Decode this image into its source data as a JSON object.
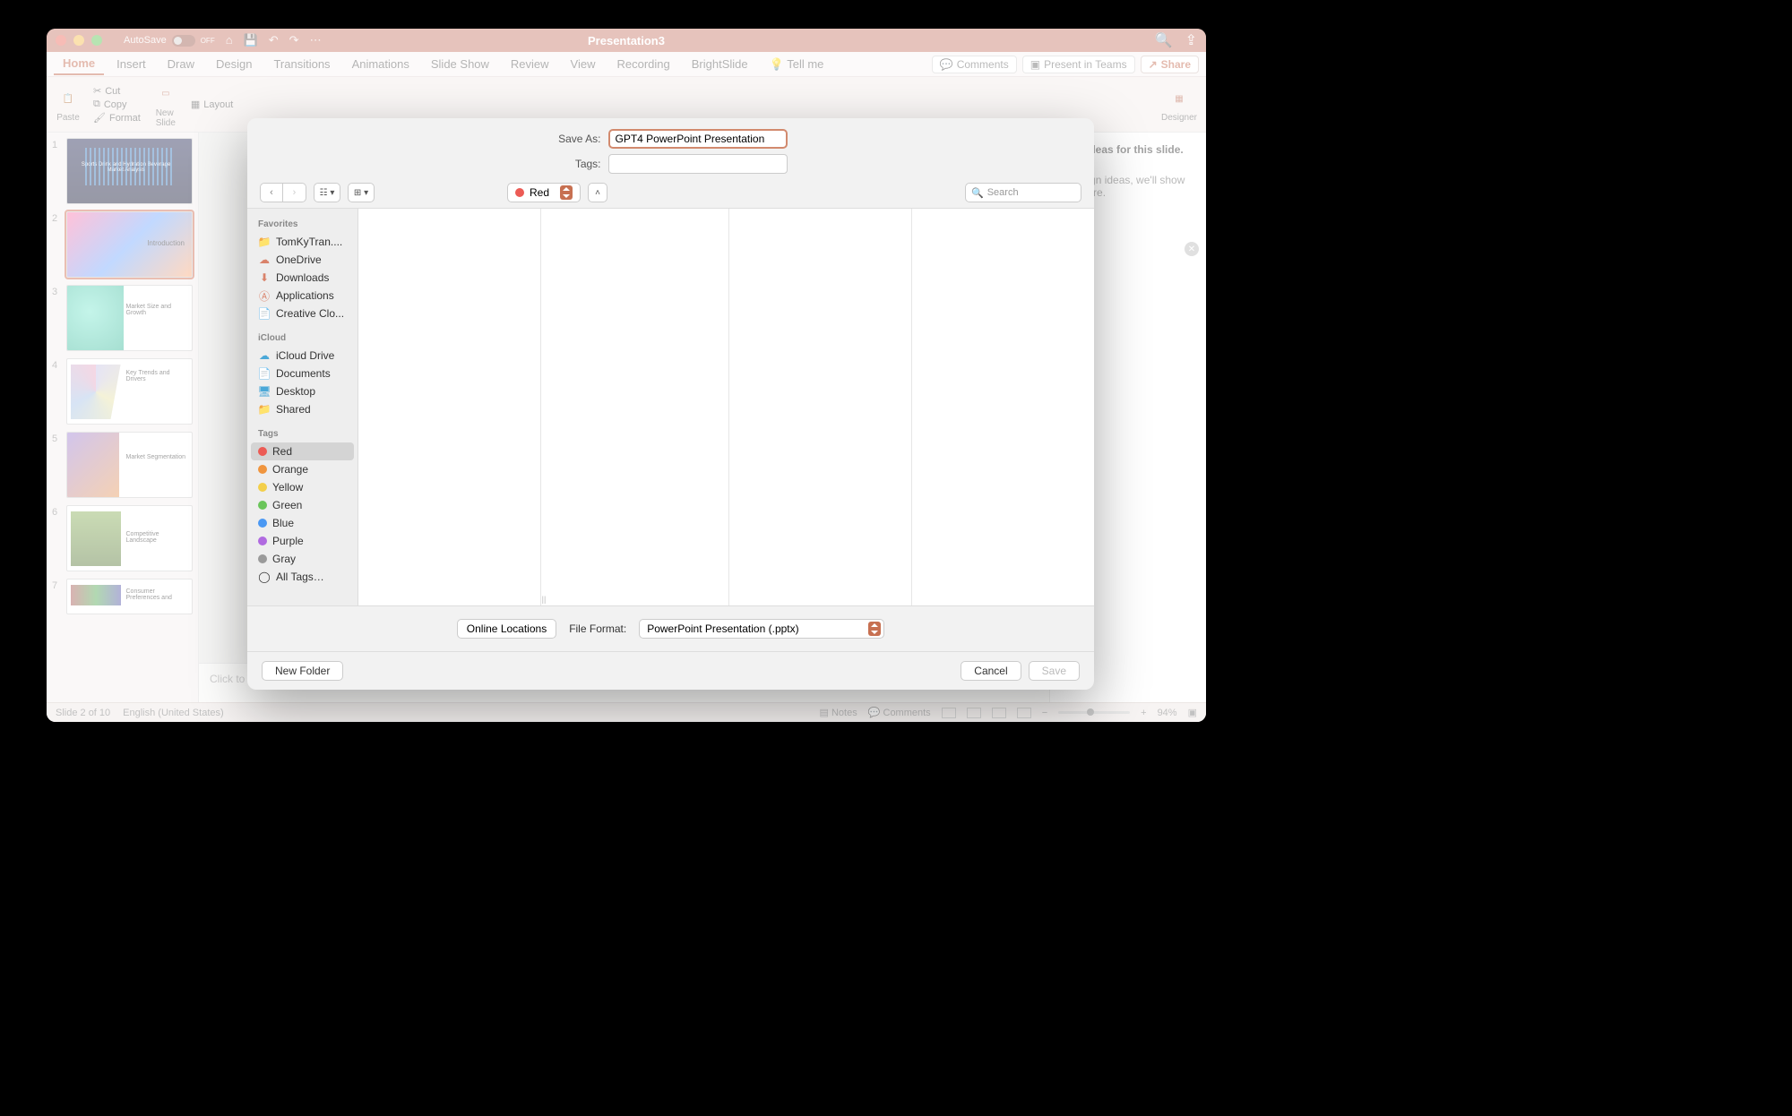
{
  "titlebar": {
    "autosave_label": "AutoSave",
    "autosave_state": "OFF",
    "title": "Presentation3"
  },
  "tabs": {
    "items": [
      "Home",
      "Insert",
      "Draw",
      "Design",
      "Transitions",
      "Animations",
      "Slide Show",
      "Review",
      "View",
      "Recording",
      "BrightSlide"
    ],
    "tellme": "Tell me",
    "comments": "Comments",
    "present_teams": "Present in Teams",
    "share": "Share"
  },
  "ribbon": {
    "paste": "Paste",
    "cut": "Cut",
    "copy": "Copy",
    "format": "Format",
    "new_slide": "New\nSlide",
    "layout": "Layout",
    "designer": "Designer"
  },
  "thumbs": [
    {
      "n": "1",
      "title": "Sports Drink and Hydration Beverage Market Analysis"
    },
    {
      "n": "2",
      "title": "Introduction"
    },
    {
      "n": "3",
      "title": "Market Size and Growth"
    },
    {
      "n": "4",
      "title": "Key Trends and Drivers"
    },
    {
      "n": "5",
      "title": "Market Segmentation"
    },
    {
      "n": "6",
      "title": "Competitive Landscape"
    },
    {
      "n": "7",
      "title": "Consumer Preferences and"
    }
  ],
  "designer_pane": {
    "heading_tail": "sign ideas for this slide.",
    "body1": "e design ideas, we'll show",
    "body2": "ight here."
  },
  "notes_placeholder": "Click to add notes",
  "status": {
    "slide": "Slide 2 of 10",
    "lang": "English (United States)",
    "notes": "Notes",
    "comments": "Comments",
    "zoom": "94%"
  },
  "dialog": {
    "save_as_label": "Save As:",
    "save_as_value": "GPT4 PowerPoint Presentation",
    "tags_label": "Tags:",
    "location": "Red",
    "search_placeholder": "Search",
    "sidebar": {
      "favorites_head": "Favorites",
      "favorites": [
        {
          "label": "TomKyTran....",
          "color": "#d9826a",
          "type": "folder"
        },
        {
          "label": "OneDrive",
          "color": "#d9826a",
          "type": "cloud"
        },
        {
          "label": "Downloads",
          "color": "#d9826a",
          "type": "download"
        },
        {
          "label": "Applications",
          "color": "#d9826a",
          "type": "apps"
        },
        {
          "label": "Creative Clo...",
          "color": "#d9826a",
          "type": "file"
        }
      ],
      "icloud_head": "iCloud",
      "icloud": [
        {
          "label": "iCloud Drive",
          "color": "#4aa8d8"
        },
        {
          "label": "Documents",
          "color": "#4aa8d8"
        },
        {
          "label": "Desktop",
          "color": "#4aa8d8"
        },
        {
          "label": "Shared",
          "color": "#4aa8d8"
        }
      ],
      "tags_head": "Tags",
      "tags": [
        {
          "label": "Red",
          "color": "#ec5b55"
        },
        {
          "label": "Orange",
          "color": "#f0953e"
        },
        {
          "label": "Yellow",
          "color": "#f3cf4a"
        },
        {
          "label": "Green",
          "color": "#6ac55a"
        },
        {
          "label": "Blue",
          "color": "#4a98f3"
        },
        {
          "label": "Purple",
          "color": "#b06ae0"
        },
        {
          "label": "Gray",
          "color": "#9a9a9a"
        },
        {
          "label": "All Tags…",
          "color": ""
        }
      ]
    },
    "online_locations": "Online Locations",
    "file_format_label": "File Format:",
    "file_format_value": "PowerPoint Presentation (.pptx)",
    "new_folder": "New Folder",
    "cancel": "Cancel",
    "save": "Save"
  }
}
